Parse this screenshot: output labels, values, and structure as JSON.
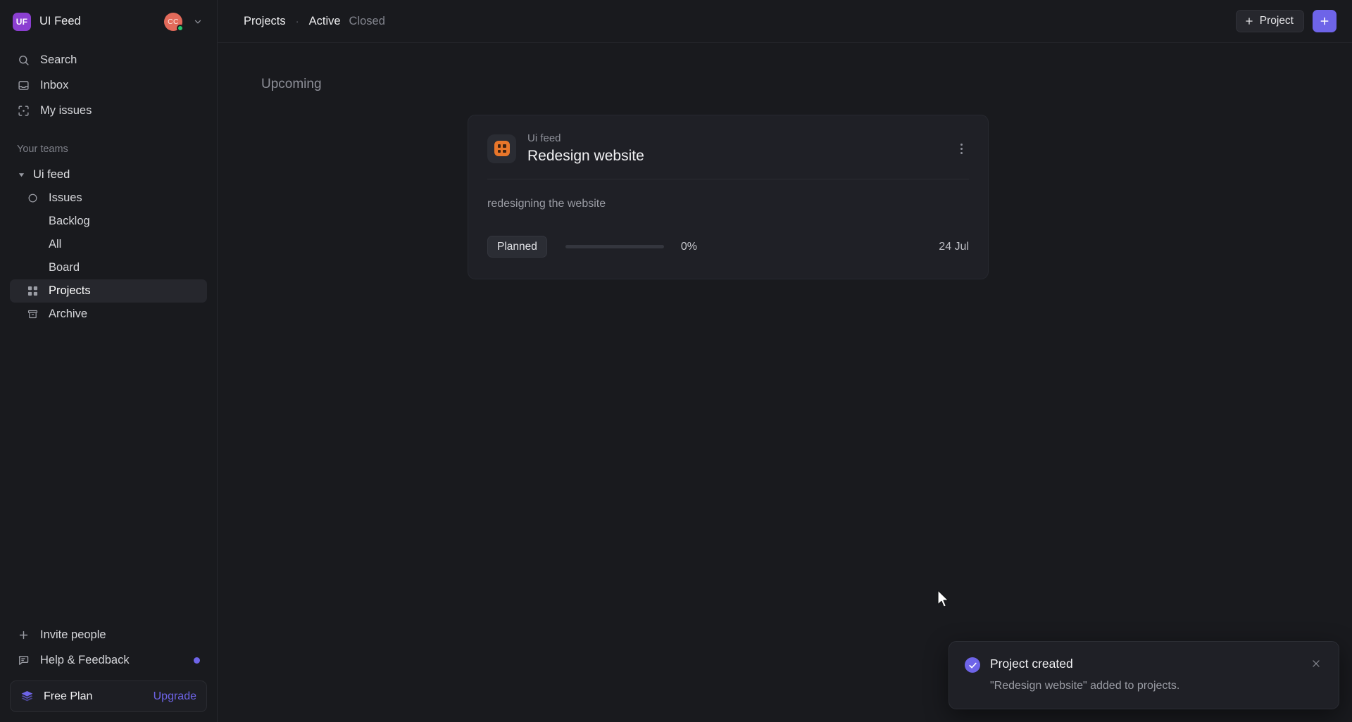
{
  "workspace": {
    "logo_initials": "UF",
    "name": "UI Feed",
    "logo_color": "#8b3fd1",
    "avatar_initials": "CC",
    "avatar_color": "#e26a5a",
    "presence_color": "#28c76f",
    "chevron_icon": "chevron-down-icon"
  },
  "sidebar": {
    "nav": [
      {
        "label": "Search",
        "icon": "search-icon"
      },
      {
        "label": "Inbox",
        "icon": "inbox-icon"
      },
      {
        "label": "My issues",
        "icon": "target-icon"
      }
    ],
    "teams_label": "Your teams",
    "team": {
      "name": "Ui feed",
      "expanded_icon": "triangle-down-icon",
      "items": [
        {
          "label": "Issues",
          "icon": "circle-icon",
          "active": false
        },
        {
          "label": "Backlog",
          "icon": "",
          "active": false
        },
        {
          "label": "All",
          "icon": "",
          "active": false
        },
        {
          "label": "Board",
          "icon": "",
          "active": false
        },
        {
          "label": "Projects",
          "icon": "grid-icon",
          "active": true
        },
        {
          "label": "Archive",
          "icon": "archive-icon",
          "active": false
        }
      ]
    },
    "footer": [
      {
        "label": "Invite people",
        "icon": "plus-icon",
        "badge": false
      },
      {
        "label": "Help & Feedback",
        "icon": "message-icon",
        "badge": true
      }
    ],
    "plan": {
      "icon": "layers-icon",
      "name": "Free Plan",
      "upgrade_label": "Upgrade",
      "accent": "#6e64e8"
    }
  },
  "topbar": {
    "breadcrumb": "Projects",
    "separator": "·",
    "tabs": [
      {
        "label": "Active",
        "active": true
      },
      {
        "label": "Closed",
        "active": false
      }
    ],
    "new_project_label": "Project",
    "new_project_icon": "plus-icon",
    "add_button_icon": "plus-icon",
    "add_button_color": "#6e64e8"
  },
  "main": {
    "group_title": "Upcoming",
    "project": {
      "team": "Ui feed",
      "title": "Redesign website",
      "icon": "grid-square-icon",
      "icon_color": "#e8762a",
      "menu_icon": "kebab-menu-icon",
      "description": "redesigning the website",
      "status": "Planned",
      "progress_percent": 0,
      "progress_label": "0%",
      "due_date": "24 Jul"
    }
  },
  "toast": {
    "icon": "check-circle-icon",
    "icon_color": "#6e64e8",
    "title": "Project created",
    "message": "\"Redesign website\" added to projects.",
    "close_icon": "close-icon"
  }
}
